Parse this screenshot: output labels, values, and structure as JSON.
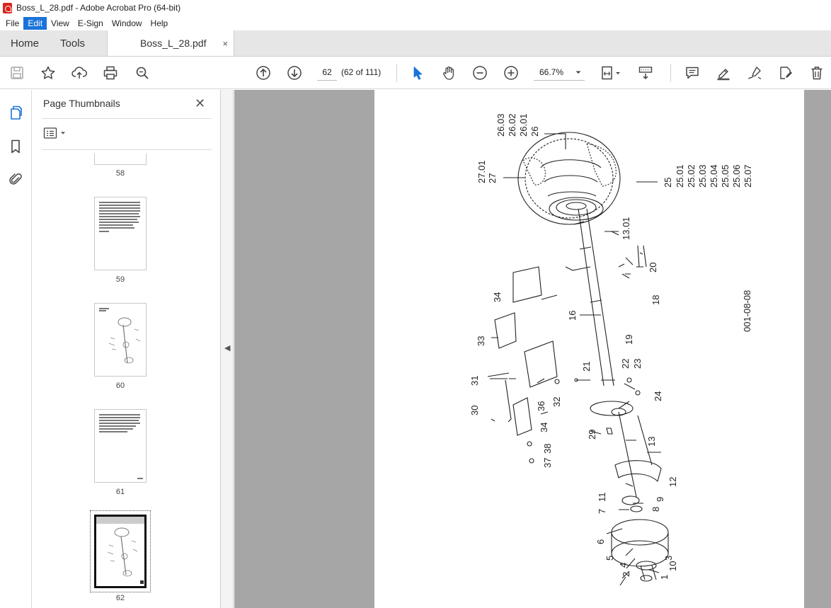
{
  "window": {
    "title": "Boss_L_28.pdf - Adobe Acrobat Pro (64-bit)"
  },
  "menu": {
    "items": [
      "File",
      "Edit",
      "View",
      "E-Sign",
      "Window",
      "Help"
    ],
    "active": "Edit"
  },
  "tabs": {
    "home": "Home",
    "tools": "Tools",
    "document": "Boss_L_28.pdf",
    "close": "×"
  },
  "toolbar": {
    "page_current": "62",
    "page_count": "(62 of 111)",
    "zoom": "66.7%"
  },
  "panel": {
    "title": "Page Thumbnails",
    "close": "✕",
    "thumbnails": [
      {
        "label": "58"
      },
      {
        "label": "59"
      },
      {
        "label": "60"
      },
      {
        "label": "61"
      },
      {
        "label": "62",
        "selected": true
      }
    ]
  },
  "drawing": {
    "callouts": {
      "c26_03": "26.03",
      "c26_02": "26.02",
      "c26_01": "26.01",
      "c26": "26",
      "c27_01": "27.01",
      "c27": "27",
      "c25": "25",
      "c25_01": "25.01",
      "c25_02": "25.02",
      "c25_03": "25.03",
      "c25_04": "25.04",
      "c25_05": "25.05",
      "c25_06": "25.06",
      "c25_07": "25.07",
      "c13_01": "13.01",
      "c20": "20",
      "c18": "18",
      "c19": "19",
      "c16": "16",
      "c34a": "34",
      "c33": "33",
      "c31": "31",
      "c30": "30",
      "c36": "36",
      "c32": "32",
      "c34b": "34",
      "c38": "38",
      "c37": "37",
      "c21": "21",
      "c22": "22",
      "c23": "23",
      "c24": "24",
      "c29": "29",
      "c13": "13",
      "c12": "12",
      "c11": "11",
      "c9": "9",
      "c7": "7",
      "c8": "8",
      "c6": "6",
      "c5": "5",
      "c4": "4",
      "c3": "3",
      "c2": "2",
      "c1": "1",
      "c10": "10"
    },
    "drawing_code": "001-08-08"
  }
}
